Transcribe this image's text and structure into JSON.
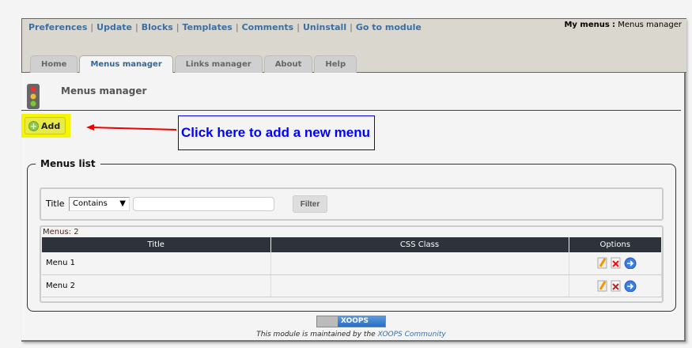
{
  "top_links": [
    "Preferences",
    "Update",
    "Blocks",
    "Templates",
    "Comments",
    "Uninstall",
    "Go to module"
  ],
  "separator": "|",
  "module_label": "My menus",
  "module_sep": ":",
  "module_page": "Menus manager",
  "tabs": [
    {
      "label": "Home"
    },
    {
      "label": "Menus manager"
    },
    {
      "label": "Links manager"
    },
    {
      "label": "About"
    },
    {
      "label": "Help"
    }
  ],
  "page_title": "Menus manager",
  "add_label": "Add",
  "callout": "Click here to add a new menu",
  "fieldset_legend": "Menus list",
  "filter": {
    "label": "Title",
    "select_value": "Contains",
    "input_value": "",
    "button": "Filter"
  },
  "count": "Menus: 2",
  "columns": [
    "Title",
    "CSS Class",
    "Options"
  ],
  "rows": [
    {
      "title": "Menu 1",
      "css": ""
    },
    {
      "title": "Menu 2",
      "css": ""
    }
  ],
  "footer": {
    "badge": "XOOPS",
    "text": "This module is maintained by the",
    "link": "XOOPS Community"
  }
}
